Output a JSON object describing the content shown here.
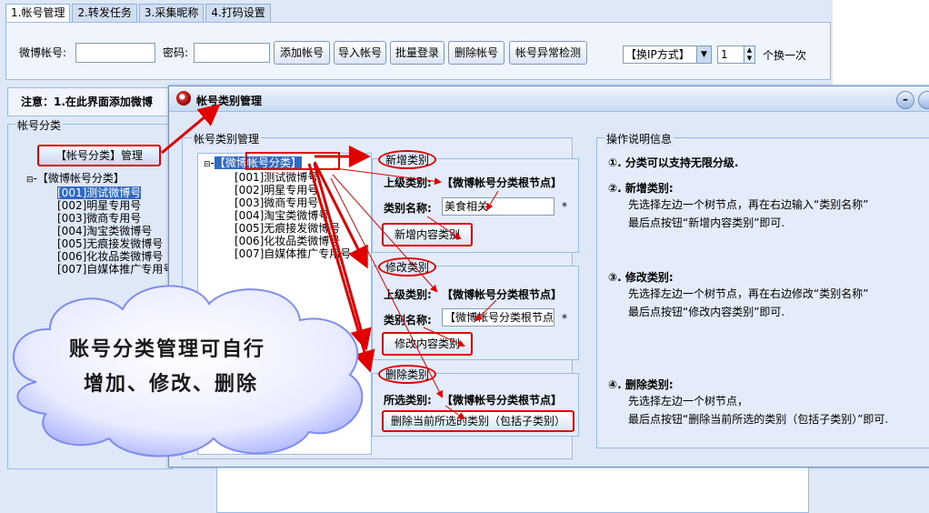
{
  "tabs": [
    {
      "label": "1.帐号管理"
    },
    {
      "label": "2.转发任务"
    },
    {
      "label": "3.采集昵称"
    },
    {
      "label": "4.打码设置"
    }
  ],
  "toolbar": {
    "account_label": "微博帐号:",
    "password_label": "密码:",
    "add_account": "添加帐号",
    "import_account": "导入帐号",
    "batch_login": "批量登录",
    "delete_account": "删除帐号",
    "check_account": "帐号异常检测",
    "ip_mode": "【换IP方式】",
    "ip_count": "1",
    "ip_suffix": "个换一次"
  },
  "notice": "注意：1.在此界面添加微博",
  "left": {
    "group_title": "帐号分类",
    "manage_button": "【帐号分类】管理",
    "tree_root": "【微博帐号分类】",
    "tree_items": [
      "[001]测试微博号",
      "[002]明星专用号",
      "[003]微商专用号",
      "[004]淘宝类微博号",
      "[005]无痕接发微博号",
      "[006]化妆品类微博号",
      "[007]自媒体推广专用号"
    ]
  },
  "dialog": {
    "title": "帐号类别管理",
    "tree_group": "帐号类别管理",
    "tree_root": "【微博帐号分类】",
    "tree_items": [
      "[001]测试微博号",
      "[002]明星专用号",
      "[003]微商专用号",
      "[004]淘宝类微博号",
      "[005]无痕接发微博号",
      "[006]化妆品类微博号",
      "[007]自媒体推广专用号"
    ],
    "add": {
      "legend": "新增类别",
      "parent_label": "上级类别:",
      "parent_value": "【微博帐号分类根节点】",
      "name_label": "类别名称:",
      "name_value": "美食相关",
      "required": "*",
      "button": "新增内容类别"
    },
    "edit": {
      "legend": "修改类别",
      "parent_label": "上级类别:",
      "parent_value": "【微博帐号分类根节点】",
      "name_label": "类别名称:",
      "name_value": "【微博帐号分类根节点",
      "required": "*",
      "button": "修改内容类别"
    },
    "delete": {
      "legend": "删除类别",
      "selected_label": "所选类别:",
      "selected_value": "【微博帐号分类根节点】",
      "button": "删除当前所选的类别（包括子类别）"
    },
    "help": {
      "legend": "操作说明信息",
      "p1": "①.  分类可以支持无限分级.",
      "p2_title": "②.  新增类别:",
      "p2_l1": "先选择左边一个树节点，再在右边输入“类别名称”",
      "p2_l2": "最后点按钮“新增内容类别”即可.",
      "p3_title": "③.  修改类别:",
      "p3_l1": "先选择左边一个树节点，再在右边修改“类别名称”",
      "p3_l2": "最后点按钮“修改内容类别”即可.",
      "p4_title": "④.  删除类别:",
      "p4_l1": "先选择左边一个树节点，",
      "p4_l2": "最后点按钮“删除当前所选的类别（包括子类别）”即可."
    }
  },
  "callout": {
    "line1": "账号分类管理可自行",
    "line2": "增加、修改、删除"
  }
}
